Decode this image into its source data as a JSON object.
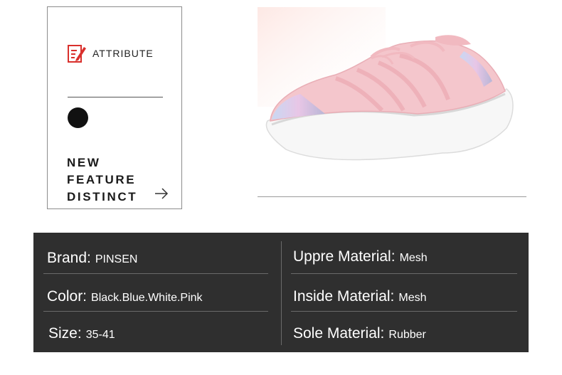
{
  "card": {
    "attribute_label": "ATTRIBUTE",
    "feature_lines": [
      "NEW",
      "FEATURE",
      "DISTINCT"
    ]
  },
  "colors": {
    "accent": "#d9302c",
    "panel": "#2f2f2f",
    "shoe": "#f4c6cc"
  },
  "specs": {
    "rows": [
      {
        "left_key": "Brand:",
        "left_value": "PINSEN",
        "right_key": "Uppre Material:",
        "right_value": "Mesh"
      },
      {
        "left_key": "Color:",
        "left_value": "Black.Blue.White.Pink",
        "right_key": "Inside Material:",
        "right_value": "Mesh"
      },
      {
        "left_key": "Size:",
        "left_value": "35-41",
        "right_key": "Sole Material:",
        "right_value": "Rubber"
      }
    ]
  }
}
